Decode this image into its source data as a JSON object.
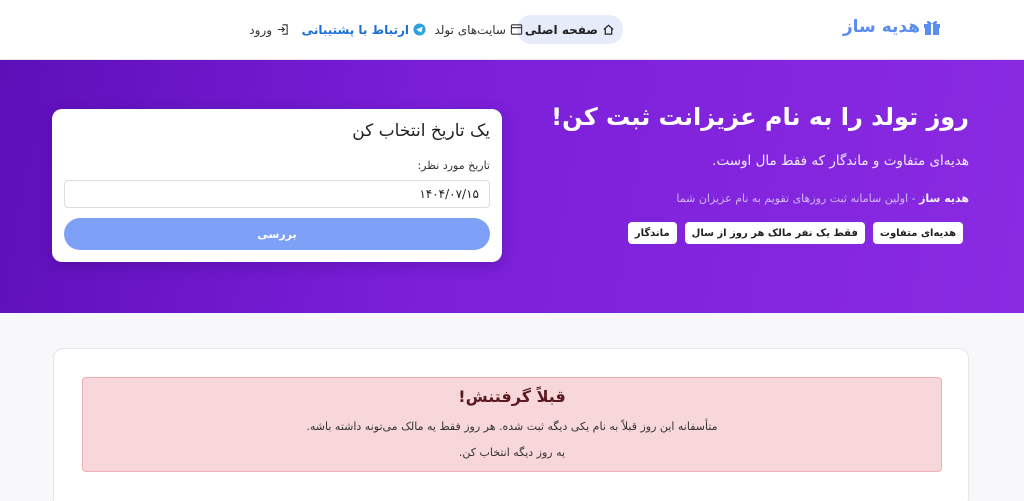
{
  "navbar": {
    "brand": "هدیه ساز",
    "items": [
      {
        "label": "صفحه اصلی",
        "icon": "home-icon"
      },
      {
        "label": "سایت‌های تولد",
        "icon": "window-icon"
      },
      {
        "label": "ارتباط با پشتیبانی",
        "icon": "telegram-icon"
      },
      {
        "label": "ورود",
        "icon": "login-icon"
      }
    ]
  },
  "hero": {
    "title": "روز تولد را به نام عزیزانت ثبت کن!",
    "subtitle": "هدیه‌ای متفاوت و ماندگار که فقط مال اوست.",
    "note_brand": "هدیه ساز",
    "note_rest": " - اولین سامانه ثبت روزهای تقویم به نام عزیزان شما",
    "chips": [
      "هدیه‌ای متفاوت",
      "فقط یک نفر مالک هر روز از سال",
      "ماندگار"
    ]
  },
  "date_card": {
    "title": "یک تاریخ انتخاب کن",
    "label": "تاریخ مورد نظر:",
    "value": "۱۴۰۴/۰۷/۱۵",
    "button": "بررسی"
  },
  "alert": {
    "title": "قبلاً گرفتنش!",
    "message": "متأسفانه این روز قبلاً به نام یکی دیگه ثبت شده. هر روز فقط یه مالک می‌تونه داشته باشه.",
    "hint": "یه روز دیگه انتخاب کن."
  },
  "colors": {
    "brand": "#5b8def",
    "hero_start": "#5d0fb8",
    "hero_end": "#8a2be2",
    "button": "#7fa0f7",
    "alert_bg": "#f8d7da"
  }
}
